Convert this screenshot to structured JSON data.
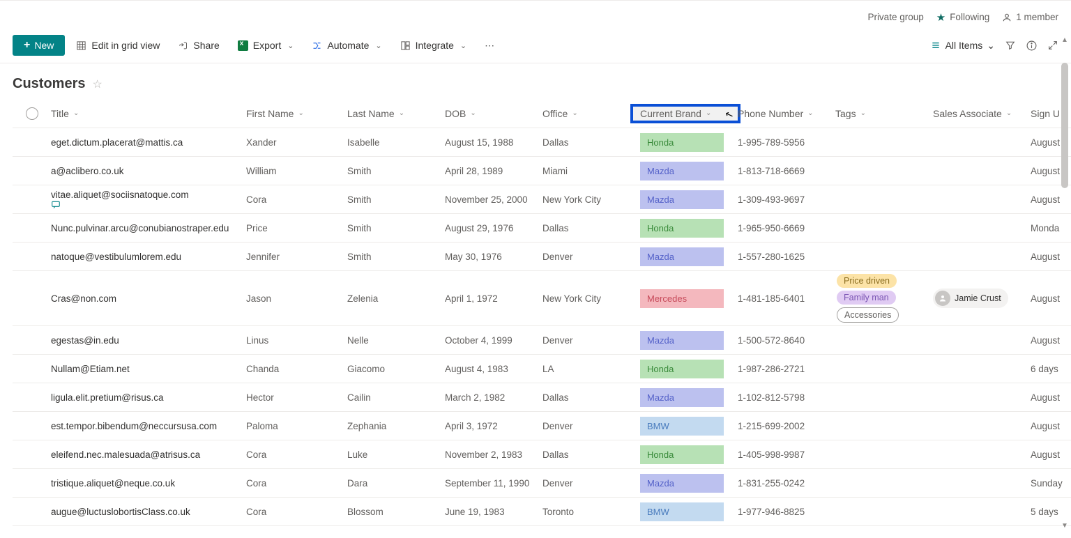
{
  "top": {
    "private_group": "Private group",
    "following": "Following",
    "members": "1 member"
  },
  "toolbar": {
    "new": "New",
    "edit_grid": "Edit in grid view",
    "share": "Share",
    "export": "Export",
    "automate": "Automate",
    "integrate": "Integrate",
    "all_items": "All Items"
  },
  "list": {
    "title": "Customers"
  },
  "columns": {
    "title": "Title",
    "first_name": "First Name",
    "last_name": "Last Name",
    "dob": "DOB",
    "office": "Office",
    "current_brand": "Current Brand",
    "phone": "Phone Number",
    "tags": "Tags",
    "sales_associate": "Sales Associate",
    "sign": "Sign U"
  },
  "rows": [
    {
      "title": "eget.dictum.placerat@mattis.ca",
      "first": "Xander",
      "last": "Isabelle",
      "dob": "August 15, 1988",
      "office": "Dallas",
      "brand": "Honda",
      "brand_cls": "honda",
      "phone": "1-995-789-5956",
      "tags": [],
      "assoc": "",
      "sign": "August"
    },
    {
      "title": "a@aclibero.co.uk",
      "first": "William",
      "last": "Smith",
      "dob": "April 28, 1989",
      "office": "Miami",
      "brand": "Mazda",
      "brand_cls": "mazda",
      "phone": "1-813-718-6669",
      "tags": [],
      "assoc": "",
      "sign": "August"
    },
    {
      "title": "vitae.aliquet@sociisnatoque.com",
      "comment": true,
      "first": "Cora",
      "last": "Smith",
      "dob": "November 25, 2000",
      "office": "New York City",
      "brand": "Mazda",
      "brand_cls": "mazda",
      "phone": "1-309-493-9697",
      "tags": [],
      "assoc": "",
      "sign": "August"
    },
    {
      "title": "Nunc.pulvinar.arcu@conubianostraper.edu",
      "first": "Price",
      "last": "Smith",
      "dob": "August 29, 1976",
      "office": "Dallas",
      "brand": "Honda",
      "brand_cls": "honda",
      "phone": "1-965-950-6669",
      "tags": [],
      "assoc": "",
      "sign": "Monda"
    },
    {
      "title": "natoque@vestibulumlorem.edu",
      "first": "Jennifer",
      "last": "Smith",
      "dob": "May 30, 1976",
      "office": "Denver",
      "brand": "Mazda",
      "brand_cls": "mazda",
      "phone": "1-557-280-1625",
      "tags": [],
      "assoc": "",
      "sign": "August"
    },
    {
      "title": "Cras@non.com",
      "first": "Jason",
      "last": "Zelenia",
      "dob": "April 1, 1972",
      "office": "New York City",
      "brand": "Mercedes",
      "brand_cls": "mercedes",
      "phone": "1-481-185-6401",
      "tags": [
        "Price driven",
        "Family man",
        "Accessories"
      ],
      "assoc": "Jamie Crust",
      "sign": "August"
    },
    {
      "title": "egestas@in.edu",
      "first": "Linus",
      "last": "Nelle",
      "dob": "October 4, 1999",
      "office": "Denver",
      "brand": "Mazda",
      "brand_cls": "mazda",
      "phone": "1-500-572-8640",
      "tags": [],
      "assoc": "",
      "sign": "August"
    },
    {
      "title": "Nullam@Etiam.net",
      "first": "Chanda",
      "last": "Giacomo",
      "dob": "August 4, 1983",
      "office": "LA",
      "brand": "Honda",
      "brand_cls": "honda",
      "phone": "1-987-286-2721",
      "tags": [],
      "assoc": "",
      "sign": "6 days"
    },
    {
      "title": "ligula.elit.pretium@risus.ca",
      "first": "Hector",
      "last": "Cailin",
      "dob": "March 2, 1982",
      "office": "Dallas",
      "brand": "Mazda",
      "brand_cls": "mazda",
      "phone": "1-102-812-5798",
      "tags": [],
      "assoc": "",
      "sign": "August"
    },
    {
      "title": "est.tempor.bibendum@neccursusa.com",
      "first": "Paloma",
      "last": "Zephania",
      "dob": "April 3, 1972",
      "office": "Denver",
      "brand": "BMW",
      "brand_cls": "bmw",
      "phone": "1-215-699-2002",
      "tags": [],
      "assoc": "",
      "sign": "August"
    },
    {
      "title": "eleifend.nec.malesuada@atrisus.ca",
      "first": "Cora",
      "last": "Luke",
      "dob": "November 2, 1983",
      "office": "Dallas",
      "brand": "Honda",
      "brand_cls": "honda",
      "phone": "1-405-998-9987",
      "tags": [],
      "assoc": "",
      "sign": "August"
    },
    {
      "title": "tristique.aliquet@neque.co.uk",
      "first": "Cora",
      "last": "Dara",
      "dob": "September 11, 1990",
      "office": "Denver",
      "brand": "Mazda",
      "brand_cls": "mazda",
      "phone": "1-831-255-0242",
      "tags": [],
      "assoc": "",
      "sign": "Sunday"
    },
    {
      "title": "augue@luctuslobortisClass.co.uk",
      "first": "Cora",
      "last": "Blossom",
      "dob": "June 19, 1983",
      "office": "Toronto",
      "brand": "BMW",
      "brand_cls": "bmw",
      "phone": "1-977-946-8825",
      "tags": [],
      "assoc": "",
      "sign": "5 days"
    }
  ],
  "tag_styles": {
    "Price driven": "price",
    "Family man": "family",
    "Accessories": "acc"
  }
}
